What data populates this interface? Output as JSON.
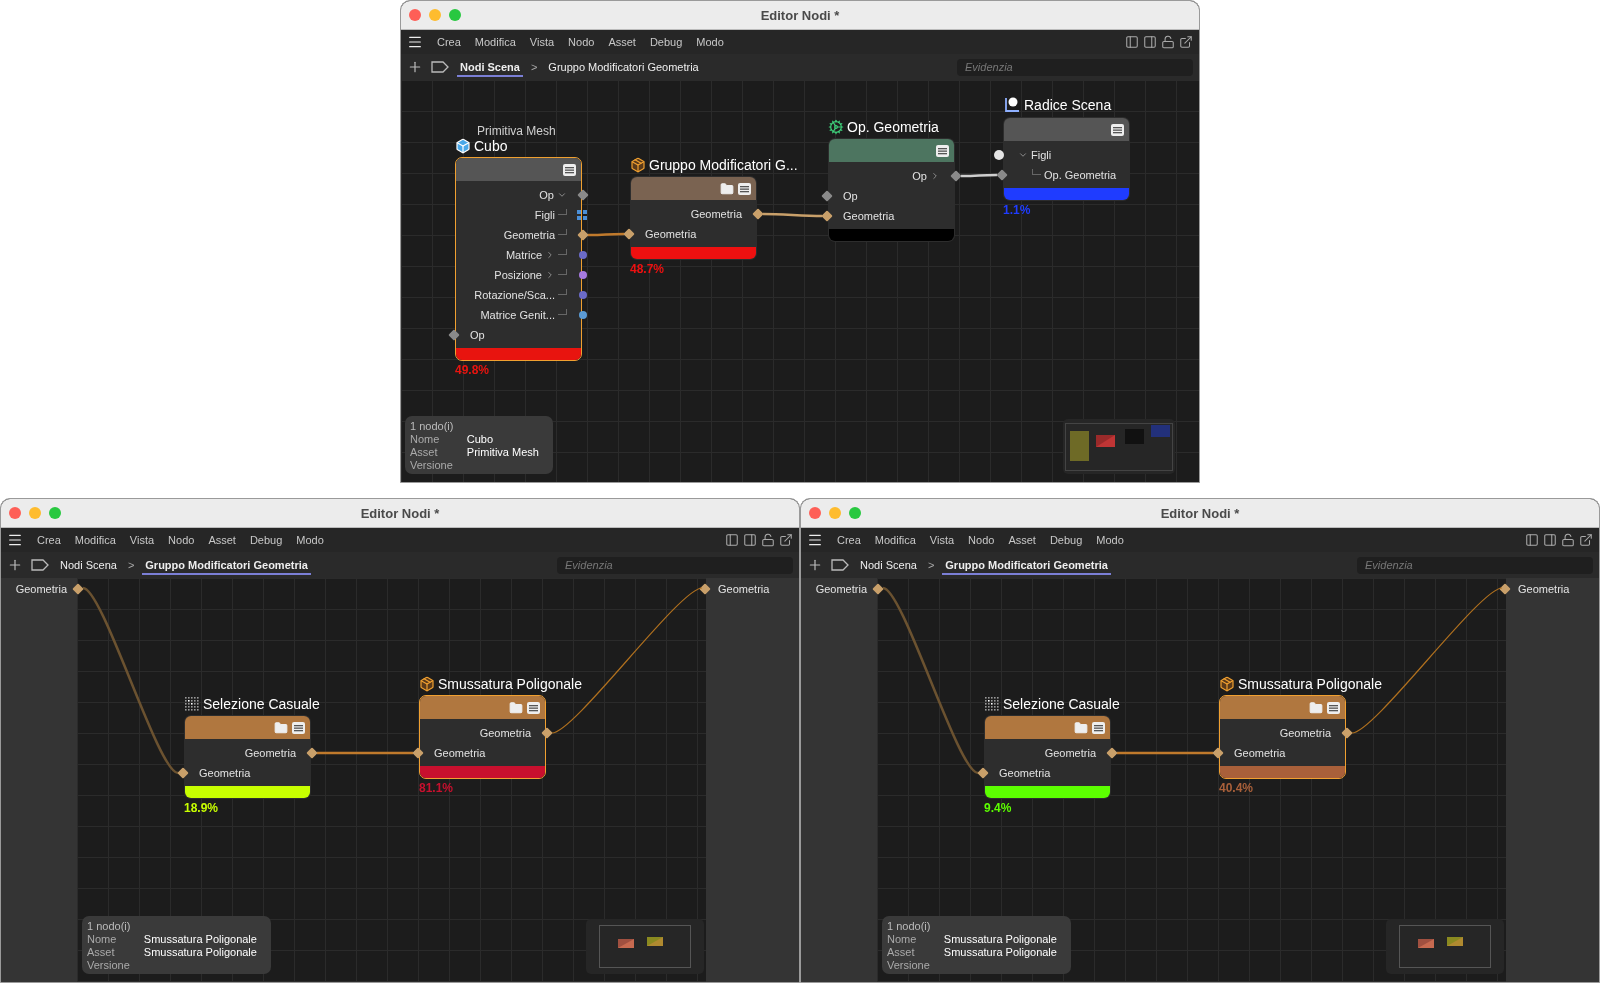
{
  "windows": [
    {
      "title": "Editor Nodi *",
      "menu": [
        "Crea",
        "Modifica",
        "Vista",
        "Nodo",
        "Asset",
        "Debug",
        "Modo"
      ],
      "breadcrumb": {
        "separator": ">",
        "items": [
          {
            "label": "Nodi Scena",
            "selected": true
          },
          {
            "label": "Gruppo Modificatori Geometria",
            "selected": false
          }
        ]
      },
      "search": {
        "placeholder": "Evidenzia"
      },
      "nodes": [
        {
          "subtitle": "Primitiva Mesh",
          "title": "Cubo",
          "kind": "cube",
          "color": "#555555",
          "folder": false,
          "selected": true,
          "load": {
            "color": "#e8140f",
            "reading": "49.8%"
          },
          "ports": [
            {
              "label": "Op",
              "output": true,
              "kind": "diamond",
              "color": "#8a8a8a",
              "expanded": true,
              "children": [
                {
                  "label": "Figli",
                  "output": true,
                  "kind": "grid",
                  "color": "#4a8fd8"
                },
                {
                  "label": "Geometria",
                  "output": true,
                  "kind": "diamond",
                  "color": "#c9a06a"
                },
                {
                  "label": "Matrice",
                  "output": true,
                  "kind": "dot",
                  "color": "#6b6bc8",
                  "expanded": false
                },
                {
                  "label": "Posizione",
                  "output": true,
                  "kind": "dot",
                  "color": "#a67ae0",
                  "expanded": false
                },
                {
                  "label": "Rotazione/Sca...",
                  "output": true,
                  "kind": "dot",
                  "color": "#6b6bc8"
                },
                {
                  "label": "Matrice Genit...",
                  "output": true,
                  "kind": "dot",
                  "color": "#5b9bd5"
                }
              ]
            },
            {
              "label": "Op",
              "output": false,
              "kind": "diamond",
              "color": "#8a8a8a"
            }
          ]
        },
        {
          "title": "Gruppo Modificatori G...",
          "kind": "package",
          "color": "#7a6351",
          "folder": true,
          "selected": false,
          "load": {
            "color": "#ee1010",
            "reading": "48.7%"
          },
          "ports": [
            {
              "label": "Geometria",
              "output": true,
              "kind": "diamond",
              "color": "#c9a06a"
            },
            {
              "label": "Geometria",
              "output": false,
              "kind": "diamond",
              "color": "#c9a06a"
            }
          ]
        },
        {
          "title": "Op. Geometria",
          "kind": "gears",
          "color": "#4d7560",
          "folder": false,
          "selected": false,
          "load": {
            "color": "#000000"
          },
          "ports": [
            {
              "label": "Op",
              "output": true,
              "kind": "diamond",
              "color": "#8a8a8a",
              "expanded": false
            },
            {
              "label": "Op",
              "output": false,
              "kind": "diamond",
              "color": "#8a8a8a"
            },
            {
              "label": "Geometria",
              "output": false,
              "kind": "diamond",
              "color": "#c9a06a"
            }
          ]
        },
        {
          "title": "Radice Scena",
          "kind": "axis",
          "color": "#555555",
          "folder": false,
          "selected": false,
          "load": {
            "color": "#1f3cff",
            "reading": "1.1%"
          },
          "ports": [
            {
              "label": "Figli",
              "output": false,
              "kind": "knob",
              "color": "#e6e6e6",
              "expanded": true,
              "children": [
                {
                  "label": "Op. Geometria",
                  "output": false,
                  "kind": "diamond",
                  "color": "#8a8a8a"
                }
              ]
            }
          ]
        }
      ],
      "info": {
        "count": "1 nodo(i)",
        "rows": [
          {
            "label": "Nome",
            "value": "Cubo"
          },
          {
            "label": "Asset",
            "value": "Primitiva Mesh"
          },
          {
            "label": "Versione"
          }
        ]
      }
    },
    {
      "title": "Editor Nodi *",
      "menu": [
        "Crea",
        "Modifica",
        "Vista",
        "Nodo",
        "Asset",
        "Debug",
        "Modo"
      ],
      "breadcrumb": {
        "separator": ">",
        "items": [
          {
            "label": "Nodi Scena",
            "selected": false
          },
          {
            "label": "Gruppo Modificatori Geometria",
            "selected": true
          }
        ]
      },
      "search": {
        "placeholder": "Evidenzia"
      },
      "group_inputs": [
        {
          "label": "Geometria",
          "color": "#c9a06a"
        }
      ],
      "group_outputs": [
        {
          "label": "Geometria",
          "color": "#c9a06a"
        }
      ],
      "nodes": [
        {
          "title": "Selezione Casuale",
          "kind": "dots",
          "color": "#b0773f",
          "folder": true,
          "selected": false,
          "load": {
            "color": "#c8ff00",
            "reading": "18.9%"
          },
          "ports": [
            {
              "label": "Geometria",
              "output": true,
              "kind": "diamond",
              "color": "#c9a06a"
            },
            {
              "label": "Geometria",
              "output": false,
              "kind": "diamond",
              "color": "#c9a06a"
            }
          ]
        },
        {
          "title": "Smussatura Poligonale",
          "kind": "package",
          "color": "#b0773f",
          "folder": true,
          "selected": true,
          "load": {
            "color": "#c8102e",
            "reading": "81.1%"
          },
          "ports": [
            {
              "label": "Geometria",
              "output": true,
              "kind": "diamond",
              "color": "#c9a06a"
            },
            {
              "label": "Geometria",
              "output": false,
              "kind": "diamond",
              "color": "#c9a06a"
            }
          ]
        }
      ],
      "info": {
        "count": "1 nodo(i)",
        "rows": [
          {
            "label": "Nome",
            "value": "Smussatura Poligonale"
          },
          {
            "label": "Asset",
            "value": "Smussatura Poligonale"
          },
          {
            "label": "Versione"
          }
        ]
      }
    },
    {
      "title": "Editor Nodi *",
      "menu": [
        "Crea",
        "Modifica",
        "Vista",
        "Nodo",
        "Asset",
        "Debug",
        "Modo"
      ],
      "breadcrumb": {
        "separator": ">",
        "items": [
          {
            "label": "Nodi Scena",
            "selected": false
          },
          {
            "label": "Gruppo Modificatori Geometria",
            "selected": true
          }
        ]
      },
      "search": {
        "placeholder": "Evidenzia"
      },
      "group_inputs": [
        {
          "label": "Geometria",
          "color": "#c9a06a"
        }
      ],
      "group_outputs": [
        {
          "label": "Geometria",
          "color": "#c9a06a"
        }
      ],
      "nodes": [
        {
          "title": "Selezione Casuale",
          "kind": "dots",
          "color": "#b0773f",
          "folder": true,
          "selected": false,
          "load": {
            "color": "#5cff00",
            "reading": "9.4%"
          },
          "ports": [
            {
              "label": "Geometria",
              "output": true,
              "kind": "diamond",
              "color": "#c9a06a"
            },
            {
              "label": "Geometria",
              "output": false,
              "kind": "diamond",
              "color": "#c9a06a"
            }
          ]
        },
        {
          "title": "Smussatura Poligonale",
          "kind": "package",
          "color": "#b0773f",
          "folder": true,
          "selected": true,
          "load": {
            "color": "#a9603a",
            "reading": "40.4%"
          },
          "ports": [
            {
              "label": "Geometria",
              "output": true,
              "kind": "diamond",
              "color": "#c9a06a"
            },
            {
              "label": "Geometria",
              "output": false,
              "kind": "diamond",
              "color": "#c9a06a"
            }
          ]
        }
      ],
      "info": {
        "count": "1 nodo(i)",
        "rows": [
          {
            "label": "Nome",
            "value": "Smussatura Poligonale"
          },
          {
            "label": "Asset",
            "value": "Smussatura Poligonale"
          },
          {
            "label": "Versione"
          }
        ]
      }
    }
  ]
}
